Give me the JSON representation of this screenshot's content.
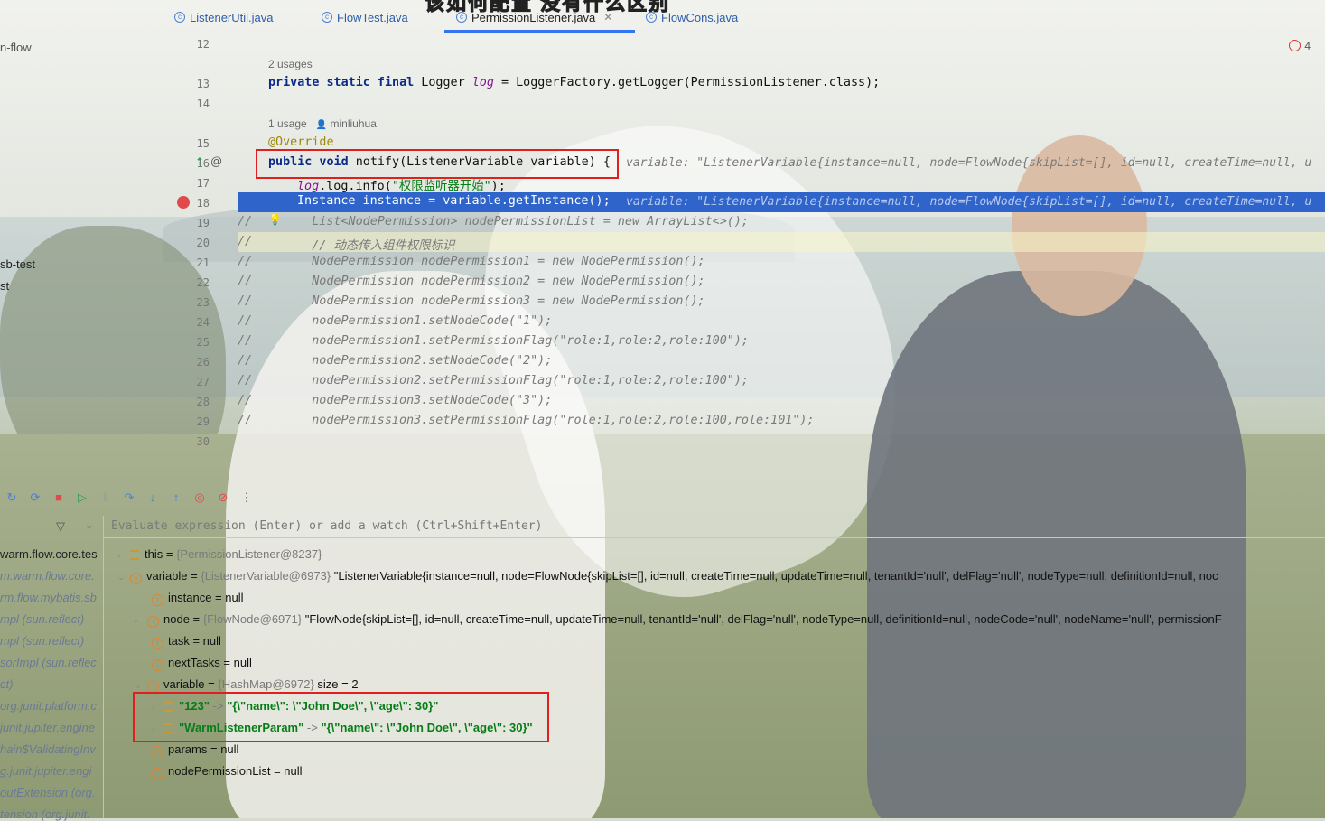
{
  "tabs": [
    {
      "label": "ListenerUtil.java"
    },
    {
      "label": "FlowTest.java"
    },
    {
      "label": "PermissionListener.java"
    },
    {
      "label": "FlowCons.java"
    }
  ],
  "banner_text": "该如何配置 没有什么区别",
  "project_tree": [
    "n-flow",
    "sb-test",
    "st"
  ],
  "error_count": "4",
  "editor": {
    "line_numbers": [
      "12",
      "13",
      "14",
      "15",
      "16",
      "17",
      "18",
      "19",
      "20",
      "21",
      "22",
      "23",
      "24",
      "25",
      "26",
      "27",
      "28",
      "29",
      "30"
    ],
    "hint_usages_1": "2 usages",
    "hint_usages_2": "1 usage",
    "hint_author": "minliuhua",
    "line13": "LoggerFactory.getLogger(PermissionListener.class);",
    "line15": "@Override",
    "line16": "notify(ListenerVariable variable) {",
    "line16_inline": "variable: \"ListenerVariable{instance=null, node=FlowNode{skipList=[], id=null, createTime=null, u",
    "line17_prefix": "log.info(",
    "line17_str": "\"权限监听器开始\"",
    "line17_suffix": ");",
    "line18": "Instance instance = variable.getInstance();",
    "line18_inline": "variable: \"ListenerVariable{instance=null, node=FlowNode{skipList=[], id=null, createTime=null, u",
    "comment_lines": [
      "    List<NodePermission> nodePermissionList = new ArrayList<>();",
      "    // 动态传入组件权限标识",
      "    NodePermission nodePermission1 = new NodePermission();",
      "    NodePermission nodePermission2 = new NodePermission();",
      "    NodePermission nodePermission3 = new NodePermission();",
      "    nodePermission1.setNodeCode(\"1\");",
      "    nodePermission1.setPermissionFlag(\"role:1,role:2,role:100\");",
      "    nodePermission2.setNodeCode(\"2\");",
      "    nodePermission2.setPermissionFlag(\"role:1,role:2,role:100\");",
      "    nodePermission3.setNodeCode(\"3\");",
      "    nodePermission3.setPermissionFlag(\"role:1,role:2,role:100,role:101\");"
    ]
  },
  "debug": {
    "eval_placeholder": "Evaluate expression (Enter) or add a watch (Ctrl+Shift+Enter)",
    "frames": [
      "warm.flow.core.tes",
      "m.warm.flow.core.",
      "rm.flow.mybatis.sb",
      "mpl (sun.reflect)",
      "mpl (sun.reflect)",
      "sorImpl (sun.reflec",
      "ct)",
      "org.junit.platform.c",
      "junit.jupiter.engine",
      "hain$ValidatingInv",
      "g.junit.jupiter.engi",
      "outExtension (org.",
      "tension (org.junit."
    ],
    "vars": {
      "this_name": "this",
      "this_val": "{PermissionListener@8237}",
      "variable_name": "variable",
      "variable_ref": "{ListenerVariable@6973}",
      "variable_str": "\"ListenerVariable{instance=null, node=FlowNode{skipList=[], id=null, createTime=null, updateTime=null, tenantId='null', delFlag='null', nodeType=null, definitionId=null, noc",
      "instance": "instance",
      "node_ref": "{FlowNode@6971}",
      "node_str": "\"FlowNode{skipList=[], id=null, createTime=null, updateTime=null, tenantId='null', delFlag='null', nodeType=null, definitionId=null, nodeCode='null', nodeName='null', permissionF",
      "node": "node",
      "task": "task",
      "nextTasks": "nextTasks",
      "inner_variable": "variable",
      "inner_variable_ref": "{HashMap@6972}",
      "inner_variable_size": "size = 2",
      "entry1_key": "\"123\"",
      "entry1_val": "\"{\\\"name\\\": \\\"John Doe\\\", \\\"age\\\": 30}\"",
      "entry2_key": "\"WarmListenerParam\"",
      "entry2_val": "\"{\\\"name\\\": \\\"John Doe\\\", \\\"age\\\": 30}\"",
      "params": "params",
      "nodePermissionList": "nodePermissionList",
      "null": "null",
      "eq": " = ",
      "arrow": " -> "
    }
  },
  "colors": {
    "accent": "#3574f0",
    "exec_line": "#2f65ca",
    "highlight_box": "#e02020"
  }
}
